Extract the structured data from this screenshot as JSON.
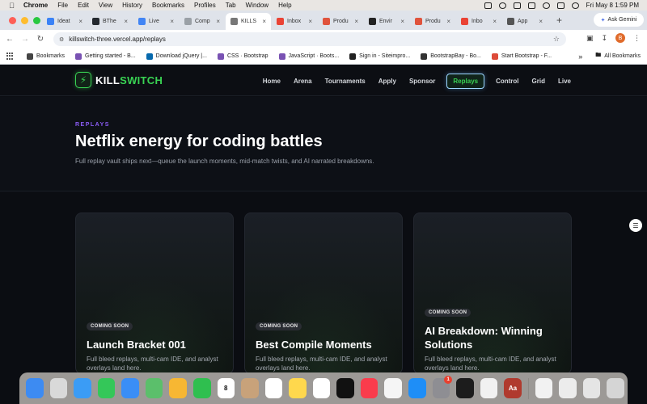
{
  "menubar": {
    "app": "Chrome",
    "items": [
      "File",
      "Edit",
      "View",
      "History",
      "Bookmarks",
      "Profiles",
      "Tab",
      "Window",
      "Help"
    ],
    "datetime": "Fri May 8  1:59 PM"
  },
  "tabs": [
    {
      "label": "Ideat",
      "color": "#3b82f6"
    },
    {
      "label": "BThe",
      "color": "#24292f"
    },
    {
      "label": "Live",
      "color": "#4285f4"
    },
    {
      "label": "Comp",
      "color": "#9aa0a6"
    },
    {
      "label": "KILLS",
      "color": "#777777",
      "active": true
    },
    {
      "label": "Inbox",
      "color": "#ea4335"
    },
    {
      "label": "Produ",
      "color": "#e0533c"
    },
    {
      "label": "Envir",
      "color": "#222222"
    },
    {
      "label": "Produ",
      "color": "#e0533c"
    },
    {
      "label": "Inbo",
      "color": "#ea4335"
    },
    {
      "label": "App",
      "color": "#555555"
    }
  ],
  "ask_gemini": "Ask Gemini",
  "toolbar": {
    "url": "killswitch-three.vercel.app/replays",
    "avatar_letter": "B"
  },
  "bookmarks": {
    "items": [
      {
        "label": "Bookmarks",
        "color": "#444444"
      },
      {
        "label": "Getting started - B...",
        "color": "#7952b3"
      },
      {
        "label": "Download jQuery |...",
        "color": "#0769ad"
      },
      {
        "label": "CSS · Bootstrap",
        "color": "#7952b3"
      },
      {
        "label": "JavaScript · Boots...",
        "color": "#7952b3"
      },
      {
        "label": "Sign in - Siteimpro...",
        "color": "#222222"
      },
      {
        "label": "BootstrapBay - Bo...",
        "color": "#333333"
      },
      {
        "label": "Start Bootstrap - F...",
        "color": "#dd4b39"
      }
    ],
    "all_bookmarks": "All Bookmarks"
  },
  "site": {
    "logo_kill": "KILL",
    "logo_switch": "SWITCH",
    "nav": [
      "Home",
      "Arena",
      "Tournaments",
      "Apply",
      "Sponsor",
      "Replays",
      "Control",
      "Grid",
      "Live"
    ],
    "active_nav": "Replays",
    "eyebrow": "REPLAYS",
    "headline": "Netflix energy for coding battles",
    "subline": "Full replay vault ships next—queue the launch moments, mid-match twists, and AI narrated breakdowns."
  },
  "cards": [
    {
      "badge": "COMING SOON",
      "title": "Launch Bracket 001",
      "desc": "Full bleed replays, multi-cam IDE, and analyst overlays land here."
    },
    {
      "badge": "COMING SOON",
      "title": "Best Compile Moments",
      "desc": "Full bleed replays, multi-cam IDE, and analyst overlays land here."
    },
    {
      "badge": "COMING SOON",
      "title": "AI Breakdown: Winning Solutions",
      "desc": "Full bleed replays, multi-cam IDE, and analyst overlays land here."
    }
  ],
  "dock": {
    "apps": [
      {
        "name": "finder",
        "color": "#3d8bf2"
      },
      {
        "name": "launchpad",
        "color": "#d9d9d9"
      },
      {
        "name": "safari",
        "color": "#3b9cf5"
      },
      {
        "name": "messages",
        "color": "#34c759"
      },
      {
        "name": "mail",
        "color": "#3a8ef6"
      },
      {
        "name": "maps",
        "color": "#5bbf6b"
      },
      {
        "name": "photos",
        "color": "#f7b733"
      },
      {
        "name": "facetime",
        "color": "#2fbf4f"
      },
      {
        "name": "calendar",
        "color": "#ffffff",
        "label": "8"
      },
      {
        "name": "contacts",
        "color": "#c8a27a"
      },
      {
        "name": "reminders",
        "color": "#ffffff"
      },
      {
        "name": "notes",
        "color": "#ffd84d"
      },
      {
        "name": "freeform",
        "color": "#ffffff"
      },
      {
        "name": "tv",
        "color": "#111111"
      },
      {
        "name": "music",
        "color": "#fa3c4c"
      },
      {
        "name": "news",
        "color": "#f5f5f5"
      },
      {
        "name": "app-store",
        "color": "#1e8ef7"
      },
      {
        "name": "system-settings",
        "color": "#8e8e93",
        "badge": "1"
      },
      {
        "name": "cursor",
        "color": "#1c1c1c"
      },
      {
        "name": "chrome",
        "color": "#f1f1f1"
      },
      {
        "name": "dictionary",
        "color": "#b03a2e",
        "label": "Aa"
      }
    ],
    "right": [
      {
        "name": "folder-stack",
        "color": "#f2f2f2"
      },
      {
        "name": "screenshot-stack",
        "color": "#ececec"
      },
      {
        "name": "downloads-stack",
        "color": "#e5e5e5"
      },
      {
        "name": "trash",
        "color": "#d5d5d5"
      }
    ]
  }
}
